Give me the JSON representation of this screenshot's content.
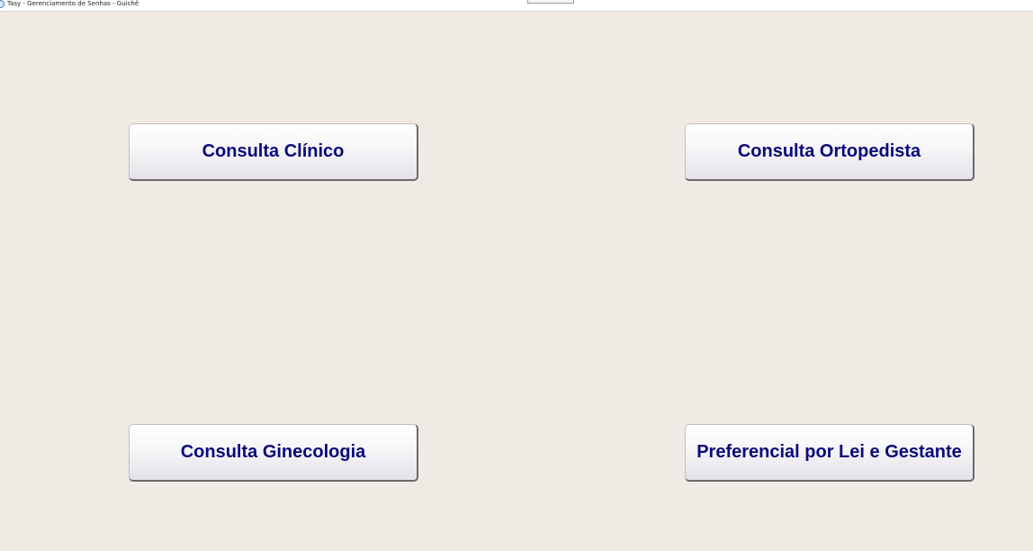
{
  "window": {
    "title": "Tasy - Gerenciamento de Senhas - Guichê",
    "icon": "tasy-app-icon"
  },
  "buttons": {
    "consulta_clinico": "Consulta Clínico",
    "consulta_ortopedista": "Consulta Ortopedista",
    "consulta_ginecologia": "Consulta Ginecologia",
    "preferencial": "Preferencial por Lei e Gestante"
  },
  "colors": {
    "background": "#efebe4",
    "button_text": "#0a0a7c"
  }
}
